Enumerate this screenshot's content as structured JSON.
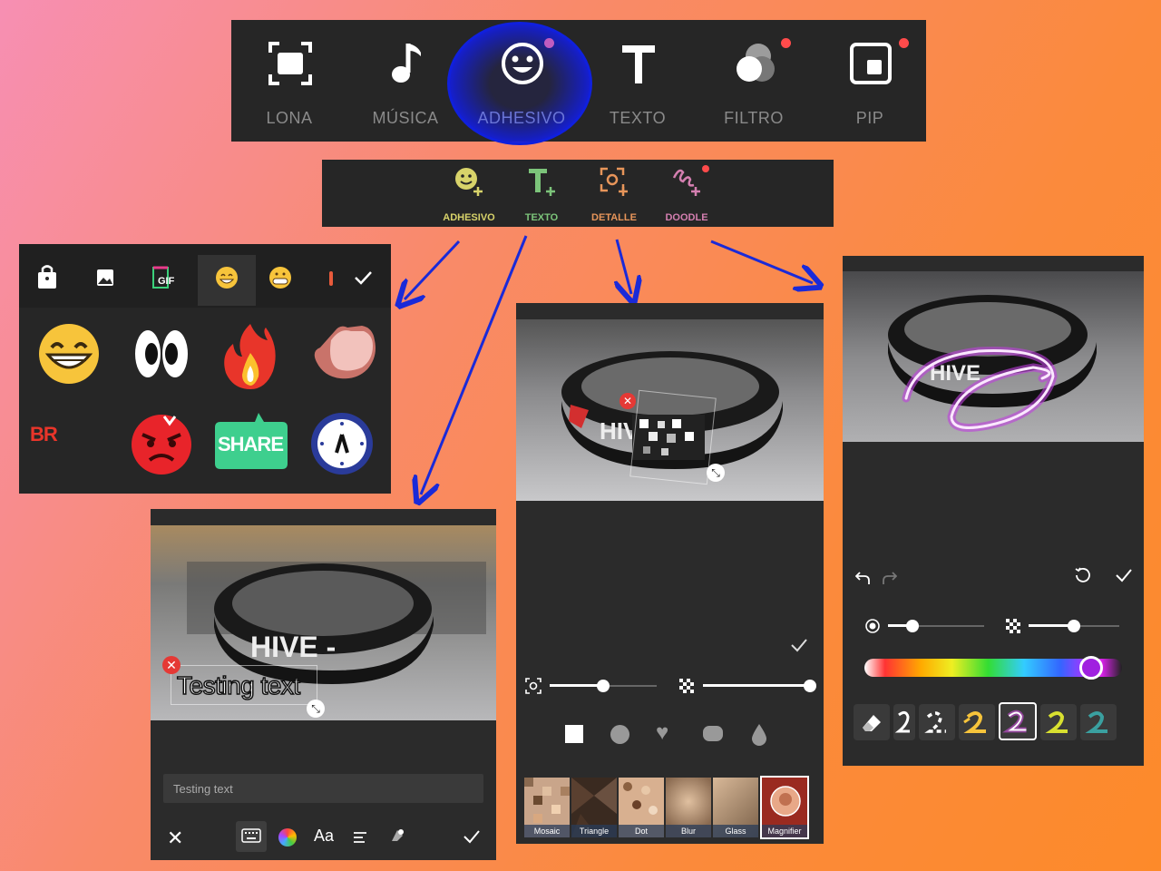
{
  "top_toolbar": {
    "items": [
      {
        "label": "LONA",
        "icon": "crop-frame-icon"
      },
      {
        "label": "MÚSICA",
        "icon": "music-note-icon"
      },
      {
        "label": "ADHESIVO",
        "icon": "smiley-icon",
        "badge": true
      },
      {
        "label": "TEXTO",
        "icon": "text-t-icon"
      },
      {
        "label": "FILTRO",
        "icon": "filter-circles-icon",
        "badge": true
      },
      {
        "label": "PIP",
        "icon": "pip-icon",
        "badge": true
      }
    ]
  },
  "sub_toolbar": {
    "items": [
      {
        "label": "ADHESIVO",
        "icon": "add-sticker-icon",
        "color": "#d8d36a"
      },
      {
        "label": "TEXTO",
        "icon": "add-text-icon",
        "color": "#7cc47a"
      },
      {
        "label": "DETALLE",
        "icon": "add-detail-icon",
        "color": "#e7955a"
      },
      {
        "label": "DOODLE",
        "icon": "add-doodle-icon",
        "color": "#d47fb0",
        "badge": true
      }
    ]
  },
  "sticker_panel": {
    "tabs": [
      "bag-icon",
      "image-icon",
      "gif-icon",
      "grin-emoji-icon",
      "grimace-emoji-icon"
    ],
    "side_label": "BR",
    "share_sticker_text": "SHARE"
  },
  "text_panel": {
    "overlay_text": "Testing text",
    "input_value": "Testing text",
    "photo_text": "HIVE -"
  },
  "mosaic_panel": {
    "photo_text": "HIV",
    "shapes": [
      "square",
      "circle",
      "heart",
      "rounded-rect",
      "drop"
    ],
    "effects": [
      "Mosaic",
      "Triangle",
      "Dot",
      "Blur",
      "Glass",
      "Magnifier"
    ],
    "brush_size_level": 0.5,
    "intensity_level": 1.0
  },
  "doodle_panel": {
    "photo_text": "HIVE",
    "brush_size_level": 0.25,
    "opacity_level": 0.5,
    "color_position": 0.88
  }
}
